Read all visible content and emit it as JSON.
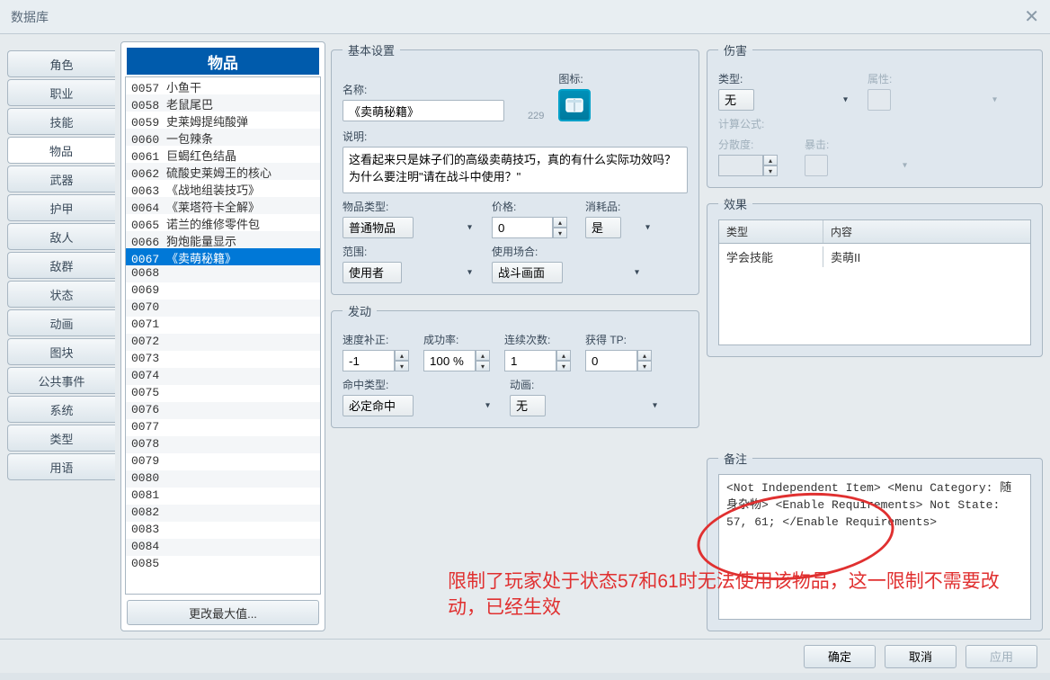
{
  "window_title": "数据库",
  "left_tabs": [
    "角色",
    "职业",
    "技能",
    "物品",
    "武器",
    "护甲",
    "敌人",
    "敌群",
    "状态",
    "动画",
    "图块",
    "公共事件",
    "系统",
    "类型",
    "用语"
  ],
  "active_tab_index": 3,
  "list_header": "物品",
  "items": [
    {
      "id": "0057",
      "name": "小鱼干"
    },
    {
      "id": "0058",
      "name": "老鼠尾巴"
    },
    {
      "id": "0059",
      "name": "史莱姆提纯酸弹"
    },
    {
      "id": "0060",
      "name": "一包辣条"
    },
    {
      "id": "0061",
      "name": "巨蝎红色结晶"
    },
    {
      "id": "0062",
      "name": "硫酸史莱姆王的核心"
    },
    {
      "id": "0063",
      "name": "《战地组装技巧》"
    },
    {
      "id": "0064",
      "name": "《莱塔符卡全解》"
    },
    {
      "id": "0065",
      "name": "诺兰的维修零件包"
    },
    {
      "id": "0066",
      "name": "狗炮能量显示"
    },
    {
      "id": "0067",
      "name": "《卖萌秘籍》"
    },
    {
      "id": "0068",
      "name": ""
    },
    {
      "id": "0069",
      "name": ""
    },
    {
      "id": "0070",
      "name": ""
    },
    {
      "id": "0071",
      "name": ""
    },
    {
      "id": "0072",
      "name": ""
    },
    {
      "id": "0073",
      "name": ""
    },
    {
      "id": "0074",
      "name": ""
    },
    {
      "id": "0075",
      "name": ""
    },
    {
      "id": "0076",
      "name": ""
    },
    {
      "id": "0077",
      "name": ""
    },
    {
      "id": "0078",
      "name": ""
    },
    {
      "id": "0079",
      "name": ""
    },
    {
      "id": "0080",
      "name": ""
    },
    {
      "id": "0081",
      "name": ""
    },
    {
      "id": "0082",
      "name": ""
    },
    {
      "id": "0083",
      "name": ""
    },
    {
      "id": "0084",
      "name": ""
    },
    {
      "id": "0085",
      "name": ""
    }
  ],
  "selected_item_index": 10,
  "change_max": "更改最大值...",
  "basic": {
    "legend": "基本设置",
    "name_label": "名称:",
    "name": "《卖萌秘籍》",
    "icon_label": "图标:",
    "icon_num": "229",
    "desc_label": "说明:",
    "desc": "这看起来只是妹子们的高级卖萌技巧，真的有什么实际功效吗？为什么要注明\"请在战斗中使用？\"",
    "item_type_label": "物品类型:",
    "item_type": "普通物品",
    "price_label": "价格:",
    "price": "0",
    "consumable_label": "消耗品:",
    "consumable": "是",
    "scope_label": "范围:",
    "scope": "使用者",
    "occasion_label": "使用场合:",
    "occasion": "战斗画面"
  },
  "invoke": {
    "legend": "发动",
    "speed_label": "速度补正:",
    "speed": "-1",
    "success_label": "成功率:",
    "success": "100 %",
    "repeat_label": "连续次数:",
    "repeat": "1",
    "tp_label": "获得 TP:",
    "tp": "0",
    "hit_type_label": "命中类型:",
    "hit_type": "必定命中",
    "anim_label": "动画:",
    "anim": "无"
  },
  "damage": {
    "legend": "伤害",
    "type_label": "类型:",
    "type": "无",
    "element_label": "属性:",
    "formula_label": "计算公式:",
    "variance_label": "分散度:",
    "crit_label": "暴击:"
  },
  "effects": {
    "legend": "效果",
    "col_type": "类型",
    "col_content": "内容",
    "rows": [
      {
        "type": "学会技能",
        "content": "卖萌II"
      }
    ]
  },
  "notes": {
    "legend": "备注",
    "lines": [
      "<Not Independent Item>",
      "<Menu Category: 随身杂物>",
      "<Enable Requirements>",
      "  Not State: 57, 61;",
      "</Enable Requirements>"
    ]
  },
  "annotation_text": "限制了玩家处于状态57和61时无法使用该物品，这一限制不需要改动，已经生效",
  "buttons": {
    "ok": "确定",
    "cancel": "取消",
    "apply": "应用"
  }
}
